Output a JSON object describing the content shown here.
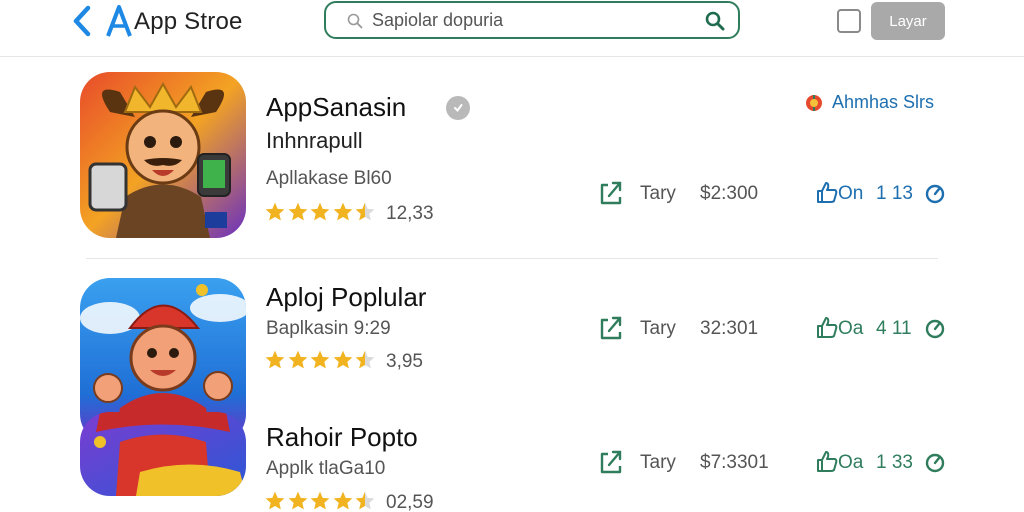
{
  "header": {
    "store_title": "App Stroe",
    "search_placeholder": "Sapiolar dopuria",
    "layer_button_label": "Layar",
    "brand_color": "#1e88e5",
    "accent_color": "#2f7d5d"
  },
  "developer": {
    "name": "Ahmhas Slrs"
  },
  "apps": [
    {
      "name": "AppSanasin",
      "subtitle": "Inhnrapull",
      "category": "Apllakase Bl60",
      "stars": 4.5,
      "rating_count": "12,33",
      "share_label": "Tary",
      "price": "$2:300",
      "like_label": "On",
      "stat": "1 13",
      "stat_color": "#1e6fb0"
    },
    {
      "name": "Aploj Poplular",
      "subtitle": "",
      "category": "Baplkasin 9:29",
      "stars": 4.5,
      "rating_count": "3,95",
      "share_label": "Tary",
      "price": "32:301",
      "like_label": "Oa",
      "stat": "4 11",
      "stat_color": "#2f7d5d"
    },
    {
      "name": "Rahoir Popto",
      "subtitle": "",
      "category": "Applk tlaGa10",
      "stars": 4.5,
      "rating_count": "02,59",
      "share_label": "Tary",
      "price": "$7:3301",
      "like_label": "Oa",
      "stat": "1 33",
      "stat_color": "#2f7d5d"
    }
  ],
  "icons": {
    "back": "chevron-left-icon",
    "logo": "app-store-logo",
    "search": "search-icon",
    "share": "share-icon",
    "like": "thumbs-up-icon",
    "timer": "timer-icon",
    "verified": "verified-icon",
    "developer": "developer-badge-icon"
  }
}
